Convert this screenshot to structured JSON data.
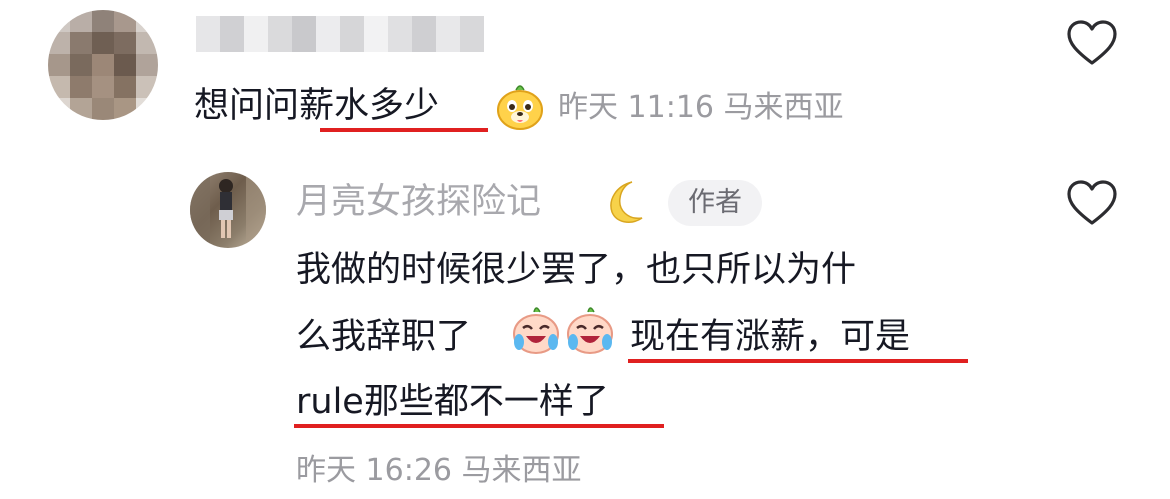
{
  "comment": {
    "text": "想问问薪水多少",
    "meta": "昨天 11:16 马来西亚",
    "emoji_icon": "dog-face-emoji"
  },
  "reply": {
    "username": "月亮女孩探险记",
    "username_emoji": "🌙",
    "author_badge": "作者",
    "lines": [
      "我做的时候很少罢了，也只所以为什",
      "么我辞职了",
      "现在有涨薪，可是",
      "rule那些都不一样了"
    ],
    "emoji_icon": "crying-laughing-emoji",
    "meta": "昨天 16:26 马来西亚"
  },
  "colors": {
    "text": "#161823",
    "meta": "#9b9ba0",
    "underline": "#e02020",
    "badge_bg": "#f2f2f4"
  }
}
